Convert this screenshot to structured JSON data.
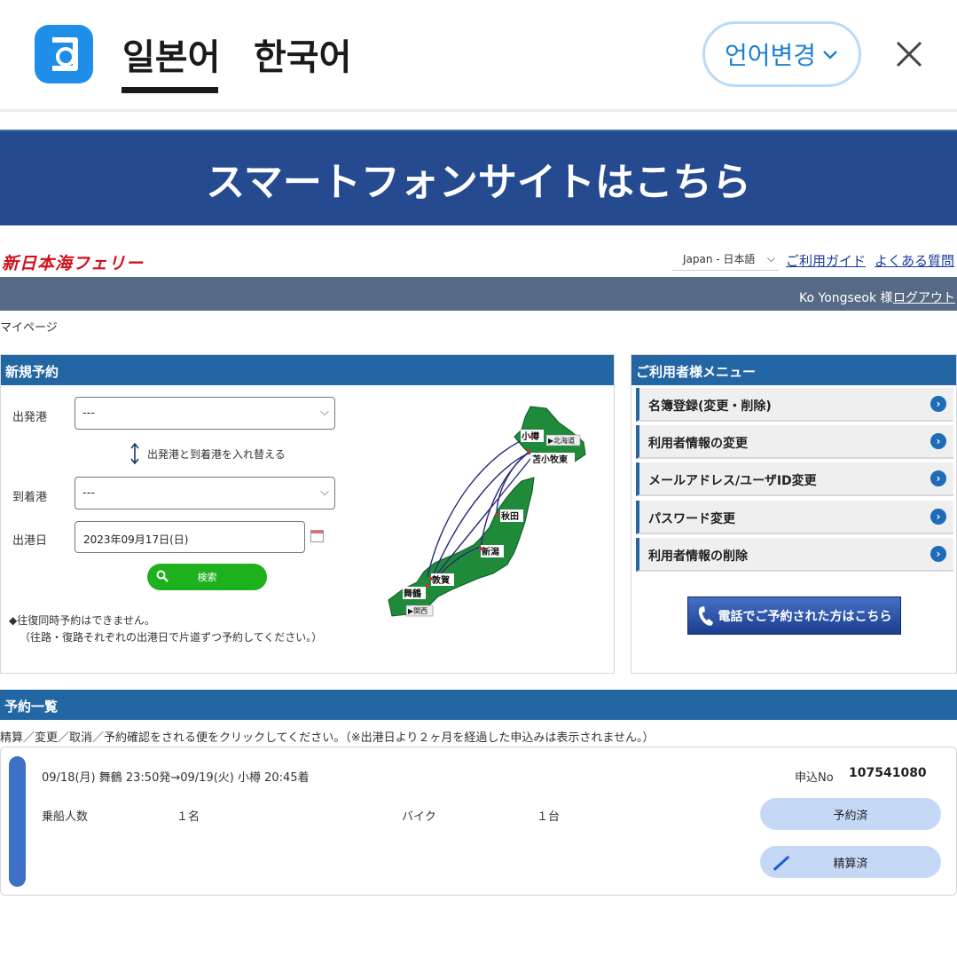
{
  "translate_bar": {
    "source_lang": "일본어",
    "target_lang": "한국어",
    "change_lang": "언어변경",
    "colors": {
      "accent": "#1f8ee8"
    }
  },
  "banner": {
    "text": "スマートフォンサイトはこちら",
    "color": "#254a8f"
  },
  "header": {
    "brand": "新日本海フェリー",
    "language_select": "Japan - 日本語",
    "guide_link": "ご利用ガイド",
    "faq_link": "よくある質問",
    "user_name": "Ko Yongseok 様",
    "logout": "ログアウト"
  },
  "breadcrumb": "マイページ",
  "new_booking": {
    "title": "新規予約",
    "departure_label": "出発港",
    "departure_value": "---",
    "swap_label": "出発港と到着港を入れ替える",
    "arrival_label": "到着港",
    "arrival_value": "---",
    "date_label": "出港日",
    "date_value": "2023年09月17日(日)",
    "search_button": "検索",
    "note_1": "◆往復同時予約はできません。",
    "note_2": "（往路・復路それぞれの出港日で片道ずつ予約してください。）",
    "map_ports": [
      "小樽",
      "苫小牧東",
      "秋田",
      "新潟",
      "敦賀",
      "舞鶴"
    ],
    "map_tags": [
      "▶北海道",
      "▶関西"
    ]
  },
  "user_menu": {
    "title": "ご利用者様メニュー",
    "items": [
      {
        "label": "名簿登録(変更・削除)"
      },
      {
        "label": "利用者情報の変更"
      },
      {
        "label": "メールアドレス/ユーザID変更"
      },
      {
        "label": "パスワード変更"
      },
      {
        "label": "利用者情報の削除"
      }
    ],
    "phone_button": "電話でご予約された方はこちら"
  },
  "reservations": {
    "title": "予約一覧",
    "note": "精算／変更／取消／予約確認をされる便をクリックしてください。（※出港日より２ヶ月を経過した申込みは表示されません。）",
    "items": [
      {
        "route": "09/18(月) 舞鶴 23:50発→09/19(火) 小樽 20:45着",
        "app_no_label": "申込No",
        "app_no": "107541080",
        "passengers_label": "乗船人数",
        "passengers": "１名",
        "vehicle_label": "バイク",
        "vehicle": "１台",
        "status_reserved": "予約済",
        "status_paid": "精算済"
      }
    ]
  }
}
